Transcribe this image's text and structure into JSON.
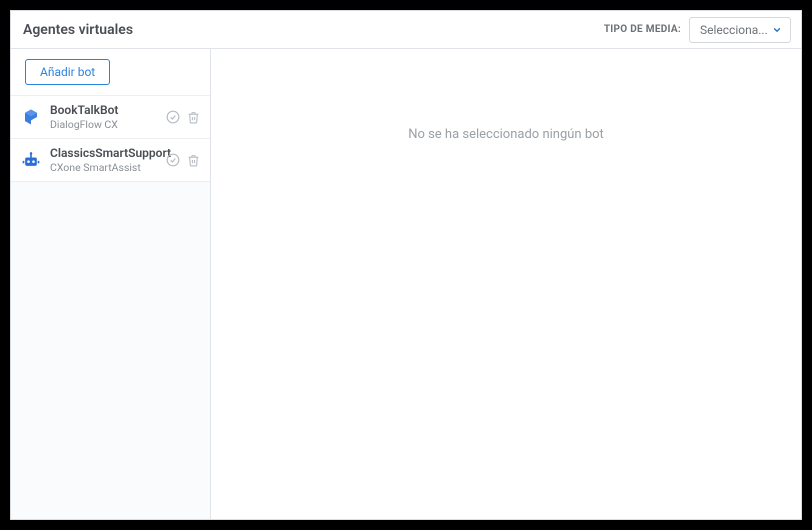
{
  "header": {
    "title": "Agentes virtuales",
    "media_type_label": "TIPO DE MEDIA:",
    "select_placeholder": "Selecciona..."
  },
  "sidebar": {
    "add_bot_label": "Añadir bot",
    "bots": [
      {
        "name": "BookTalkBot",
        "provider": "DialogFlow CX",
        "icon": "dialogflow"
      },
      {
        "name": "ClassicsSmartSupport",
        "provider": "CXone SmartAssist",
        "icon": "cxone"
      }
    ]
  },
  "main": {
    "empty_message": "No se ha seleccionado ningún bot"
  }
}
